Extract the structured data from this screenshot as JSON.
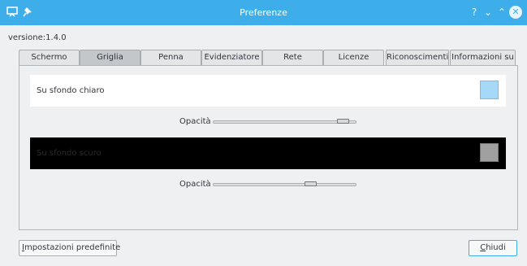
{
  "window": {
    "title": "Preferenze",
    "help_glyph": "?",
    "minimize_glyph": "⌄",
    "maximize_glyph": "⌃",
    "close_glyph": "✕",
    "icons": [
      "app-screen-icon",
      "pin-icon"
    ]
  },
  "version_text": "versione:1.4.0",
  "tabs": [
    {
      "label": "Schermo",
      "active": false
    },
    {
      "label": "Griglia",
      "active": true
    },
    {
      "label": "Penna",
      "active": false
    },
    {
      "label": "Evidenziatore",
      "active": false
    },
    {
      "label": "Rete",
      "active": false
    },
    {
      "label": "Licenze",
      "active": false
    },
    {
      "label": "Riconoscimenti",
      "active": false
    },
    {
      "label": "Informazioni su",
      "active": false
    }
  ],
  "grid": {
    "light": {
      "label": "Su sfondo chiaro",
      "background": "#ffffff",
      "text_color": "#31363b",
      "swatch_color": "#a6d8f7",
      "opacity_label": "Opacità",
      "opacity_value": 0.95
    },
    "dark": {
      "label": "Su sfondo scuro",
      "background": "#000000",
      "text_color": "#2b2b2b",
      "swatch_color": "#a0a0a0",
      "opacity_label": "Opacità",
      "opacity_value": 0.7
    }
  },
  "footer": {
    "defaults_first": "I",
    "defaults_rest": "mpostazioni predefinite",
    "close_first": "C",
    "close_rest": "hiudi"
  },
  "colors": {
    "accent": "#3daee9",
    "window_bg": "#eff0f1"
  }
}
